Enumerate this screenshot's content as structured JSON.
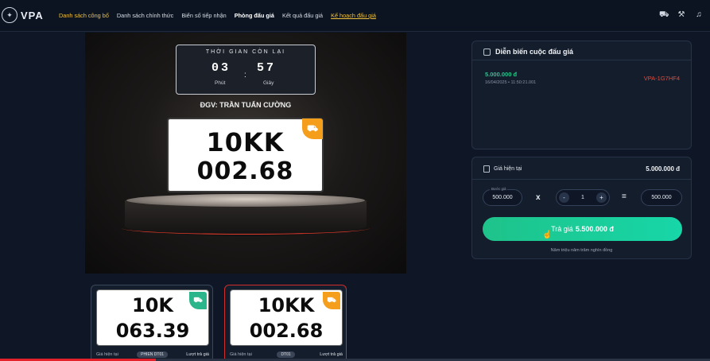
{
  "nav": {
    "logo_text": "VPA",
    "items": [
      {
        "label": "Danh sách công bố",
        "style": "gold"
      },
      {
        "label": "Danh sách chính thức",
        "style": ""
      },
      {
        "label": "Biển số tiếp nhận",
        "style": ""
      },
      {
        "label": "Phòng đấu giá",
        "style": "bold"
      },
      {
        "label": "Kết quả đấu giá",
        "style": ""
      },
      {
        "label": "Kế hoạch đấu giá",
        "style": "under"
      }
    ],
    "icons": [
      "cart-icon",
      "gavel-icon",
      "bell-icon"
    ]
  },
  "stage": {
    "timer_title": "THỜI GIAN CÒN LẠI",
    "minutes": "03",
    "minutes_label": "Phút",
    "separator": ":",
    "seconds": "57",
    "seconds_label": "Giây",
    "auctioneer": "ĐGV: TRẦN TUẤN CƯỜNG",
    "plate_line1": "10KK",
    "plate_line2": "002.68",
    "plate_icon": "truck-icon"
  },
  "history": {
    "title": "Diễn biến cuộc đấu giá",
    "entries": [
      {
        "price": "5.000.000 đ",
        "time": "16/04/2025 • 11:50:21.001",
        "user": "VPA-1G7HF4"
      }
    ]
  },
  "bid": {
    "current_label": "Giá hiện tại",
    "current_value": "5.000.000 đ",
    "step_label": "Bước giá",
    "step_value": "500.000",
    "multiply": "x",
    "minus": "-",
    "quantity": "1",
    "plus": "+",
    "equals": "=",
    "total": "500.000",
    "submit_prefix": "Trả giá",
    "submit_amount": "5.500.000 đ",
    "submit_hint": "Năm triệu năm trăm nghìn đồng"
  },
  "lots": [
    {
      "line1": "10K",
      "line2": "063.39",
      "price_label": "Giá hiện tại",
      "tag": "PHIEN DT01",
      "link": "Lượt trả giá",
      "badge_color": "#2bb58a"
    },
    {
      "line1": "10KK",
      "line2": "002.68",
      "price_label": "Giá hiện tại",
      "tag": "DT01",
      "link": "Lượt trả giá",
      "badge_color": "#f59e1b"
    }
  ],
  "video_progress": 0.22
}
